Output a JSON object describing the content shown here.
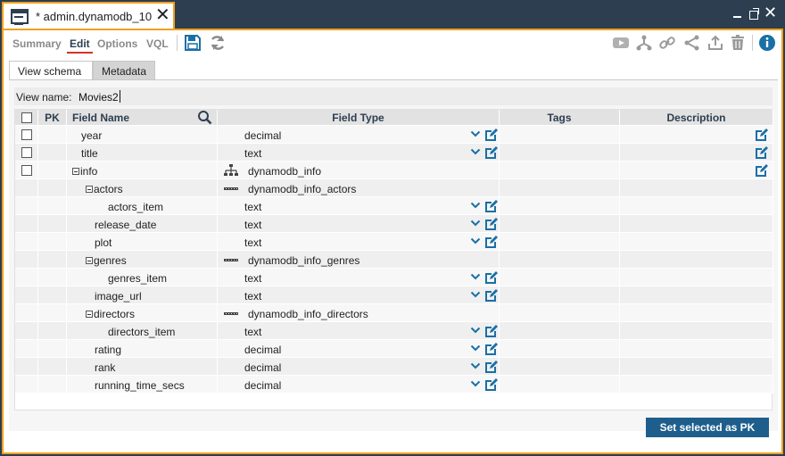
{
  "window": {
    "tab_title": "* admin.dynamodb_10",
    "close_glyph": "✕",
    "accent": "#f0a020",
    "chrome": "#2d3e50"
  },
  "toolbar": {
    "tabs": [
      "Summary",
      "Edit",
      "Options",
      "VQL"
    ],
    "active_tab": "Edit"
  },
  "subtabs": [
    "View schema",
    "Metadata"
  ],
  "view_name": {
    "label": "View name:",
    "value": "Movies2"
  },
  "columns": [
    "PK",
    "Field Name",
    "Field Type",
    "Tags",
    "Description"
  ],
  "rows": [
    {
      "name": "year",
      "type": "decimal",
      "indent": 0,
      "kind": "simple",
      "desc_edit": true
    },
    {
      "name": "title",
      "type": "text",
      "indent": 0,
      "kind": "simple",
      "desc_edit": true
    },
    {
      "name": "info",
      "type": "dynamodb_info",
      "indent": 0,
      "kind": "object",
      "expander": true,
      "desc_edit": true
    },
    {
      "name": "actors",
      "type": "dynamodb_info_actors",
      "indent": 1,
      "kind": "array",
      "expander": true
    },
    {
      "name": "actors_item",
      "type": "text",
      "indent": 2,
      "kind": "simple"
    },
    {
      "name": "release_date",
      "type": "text",
      "indent": 1,
      "kind": "simple"
    },
    {
      "name": "plot",
      "type": "text",
      "indent": 1,
      "kind": "simple"
    },
    {
      "name": "genres",
      "type": "dynamodb_info_genres",
      "indent": 1,
      "kind": "array",
      "expander": true
    },
    {
      "name": "genres_item",
      "type": "text",
      "indent": 2,
      "kind": "simple"
    },
    {
      "name": "image_url",
      "type": "text",
      "indent": 1,
      "kind": "simple"
    },
    {
      "name": "directors",
      "type": "dynamodb_info_directors",
      "indent": 1,
      "kind": "array",
      "expander": true
    },
    {
      "name": "directors_item",
      "type": "text",
      "indent": 2,
      "kind": "simple"
    },
    {
      "name": "rating",
      "type": "decimal",
      "indent": 1,
      "kind": "simple"
    },
    {
      "name": "rank",
      "type": "decimal",
      "indent": 1,
      "kind": "simple"
    },
    {
      "name": "running_time_secs",
      "type": "decimal",
      "indent": 1,
      "kind": "simple"
    }
  ],
  "buttons": {
    "set_pk": "Set selected as PK"
  },
  "colors": {
    "primary_blue": "#1d5e8c",
    "icon_blue": "#1a6fa6",
    "active_underline": "#d0342c"
  }
}
